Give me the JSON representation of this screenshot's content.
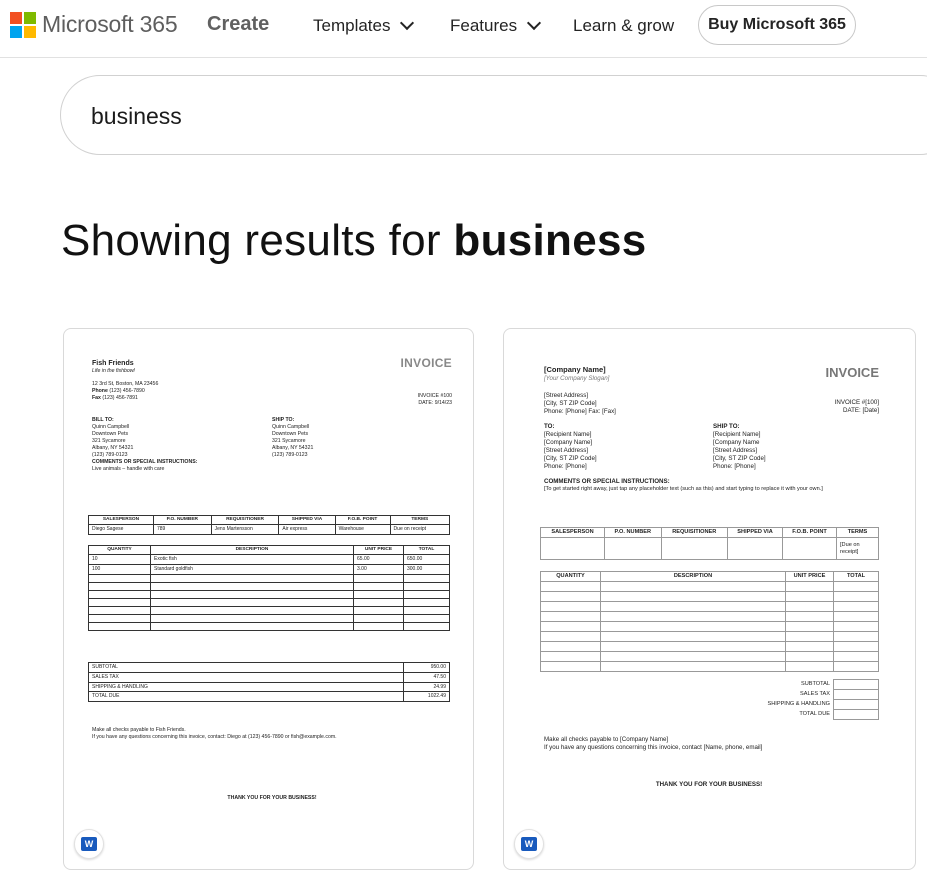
{
  "nav": {
    "brand": "Microsoft 365",
    "create": "Create",
    "templates": "Templates",
    "features": "Features",
    "learn": "Learn & grow",
    "buy": "Buy Microsoft 365",
    "logo_colors": [
      "#f25022",
      "#7fba00",
      "#00a4ef",
      "#ffb900"
    ]
  },
  "search": {
    "value": "business"
  },
  "results": {
    "prefix": "Showing results for ",
    "query": "business"
  },
  "card1": {
    "company": "Fish Friends",
    "slogan": "Life in the fishbowl",
    "address": "12 3rd St, Boston, MA 23456",
    "phone_label": "Phone",
    "phone": "(123) 456-7890",
    "fax_label": "Fax",
    "fax": "(123) 456-7891",
    "title": "INVOICE",
    "invoice_no": "INVOICE #100",
    "date": "DATE: 9/14/23",
    "bill_to_label": "BILL TO:",
    "bill_to": [
      "Quinn Campbell",
      "Downtown Pets",
      "321 Sycamore",
      "Albany, NY 54321",
      "(123) 789-0123"
    ],
    "ship_to_label": "SHIP TO:",
    "ship_to": [
      "Quinn Campbell",
      "Downtown Pets",
      "321 Sycamore",
      "Albany, NY 54321",
      "(123) 789-0123"
    ],
    "comments_label": "COMMENTS OR SPECIAL INSTRUCTIONS:",
    "comments": "Live animals – handle with care",
    "order_headers": [
      "SALESPERSON",
      "P.O. NUMBER",
      "REQUISITIONER",
      "SHIPPED VIA",
      "F.O.B. POINT",
      "TERMS"
    ],
    "order_row": [
      "Diego Sagese",
      "789",
      "Jens Martensson",
      "Air express",
      "Warehouse",
      "Due on receipt"
    ],
    "item_headers": [
      "QUANTITY",
      "DESCRIPTION",
      "UNIT PRICE",
      "TOTAL"
    ],
    "items": [
      [
        "10",
        "Exotic fish",
        "65.00",
        "650.00"
      ],
      [
        "100",
        "Standard goldfish",
        "3.00",
        "300.00"
      ]
    ],
    "totals": [
      [
        "SUBTOTAL",
        "950.00"
      ],
      [
        "SALES TAX",
        "47.50"
      ],
      [
        "SHIPPING & HANDLING",
        "24.99"
      ],
      [
        "TOTAL DUE",
        "1022.49"
      ]
    ],
    "footer1": "Make all checks payable to Fish Friends.",
    "footer2": "If you have any questions concerning this invoice, contact: Diego at (123) 456-7890 or fish@example.com.",
    "thanks": "THANK YOU FOR YOUR BUSINESS!"
  },
  "card2": {
    "company": "[Company Name]",
    "slogan": "[Your Company Slogan]",
    "address1": "[Street Address]",
    "address2": "[City, ST ZIP Code]",
    "phone": "Phone: [Phone]  Fax: [Fax]",
    "title": "INVOICE",
    "invoice_no": "INVOICE #[100]",
    "date": "DATE: [Date]",
    "to_label": "TO:",
    "to": [
      "[Recipient Name]",
      "[Company Name]",
      "[Street Address]",
      "[City, ST ZIP Code]",
      "Phone: [Phone]"
    ],
    "ship_to_label": "SHIP TO:",
    "ship_to": [
      "[Recipient Name]",
      "[Company Name",
      "[Street Address]",
      "[City, ST ZIP Code]",
      "Phone: [Phone]"
    ],
    "comments_label": "COMMENTS OR SPECIAL INSTRUCTIONS:",
    "comments": "[To get started right away, just tap any placeholder text (such as this) and start typing to replace it with your own.]",
    "order_headers": [
      "SALESPERSON",
      "P.O. NUMBER",
      "REQUISITIONER",
      "SHIPPED VIA",
      "F.O.B. POINT",
      "TERMS"
    ],
    "terms_value": "[Due on receipt]",
    "item_headers": [
      "QUANTITY",
      "DESCRIPTION",
      "UNIT PRICE",
      "TOTAL"
    ],
    "totals": [
      "SUBTOTAL",
      "SALES TAX",
      "SHIPPING & HANDLING",
      "TOTAL DUE"
    ],
    "footer1": "Make all checks payable to [Company Name]",
    "footer2": "If you have any questions concerning this invoice, contact [Name, phone, email]",
    "thanks": "THANK YOU FOR YOUR BUSINESS!"
  }
}
